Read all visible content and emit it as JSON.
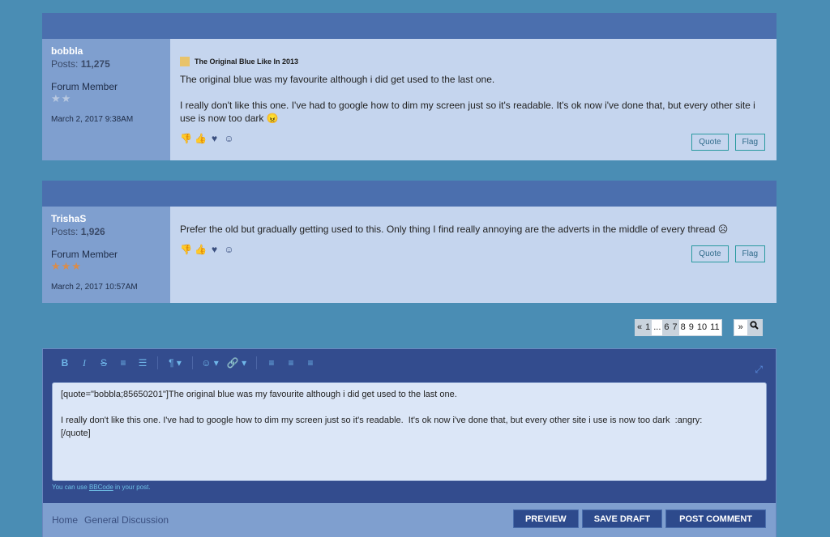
{
  "posts": [
    {
      "username": "bobbla",
      "posts_label": "Posts:",
      "posts_count": "11,275",
      "role": "Forum Member",
      "stars": "★★",
      "date": "March 2, 2017 9:38AM",
      "thread_title": "The Original Blue Like In 2013",
      "paragraphs": [
        "The original blue was my favourite although i did get used to the last one.",
        "I really don't like this one. I've had to google how to dim my screen just so it's readable. It's ok now i've done that, but every other site i use is now too dark 😠"
      ],
      "quote_label": "Quote",
      "flag_label": "Flag"
    },
    {
      "username": "TrishaS",
      "posts_label": "Posts:",
      "posts_count": "1,926",
      "role": "Forum Member",
      "stars": "★★★",
      "date": "March 2, 2017 10:57AM",
      "paragraphs": [
        "Prefer the old but gradually getting used to this. Only thing I find really annoying are the adverts in the middle of every thread ☹"
      ],
      "quote_label": "Quote",
      "flag_label": "Flag"
    }
  ],
  "reactions": [
    "👎",
    "👍",
    "♥",
    "☺"
  ],
  "pager": {
    "prev": "«",
    "pages": [
      "1",
      "...",
      "6",
      "7",
      "8",
      "9",
      "10",
      "11"
    ],
    "next": "»",
    "search_icon": "search-icon"
  },
  "editor": {
    "toolbar": [
      "B",
      "I",
      "S",
      "≡",
      "☰",
      "¶ ▾",
      "☺ ▾",
      "🔗 ▾",
      "≡",
      "≡",
      "≡"
    ],
    "expand_icon": "⤢",
    "content": "[quote=\"bobbla;85650201\"]The original blue was my favourite although i did get used to the last one.\n\nI really don't like this one. I've had to google how to dim my screen just so it's readable.  It's ok now i've done that, but every other site i use is now too dark  :angry:\n[/quote]",
    "hint_prefix": "You can use ",
    "hint_link": "BBCode",
    "hint_suffix": " in your post."
  },
  "footer": {
    "crumbs": [
      "Home",
      "General Discussion"
    ],
    "preview": "PREVIEW",
    "save_draft": "SAVE DRAFT",
    "post_comment": "POST COMMENT"
  },
  "colors": {
    "background": "#4a8db4",
    "header_bar": "#4b6fae",
    "author_panel": "#7f9fcf",
    "content_panel": "#c5d5ee",
    "editor_bg": "#334c8e"
  }
}
